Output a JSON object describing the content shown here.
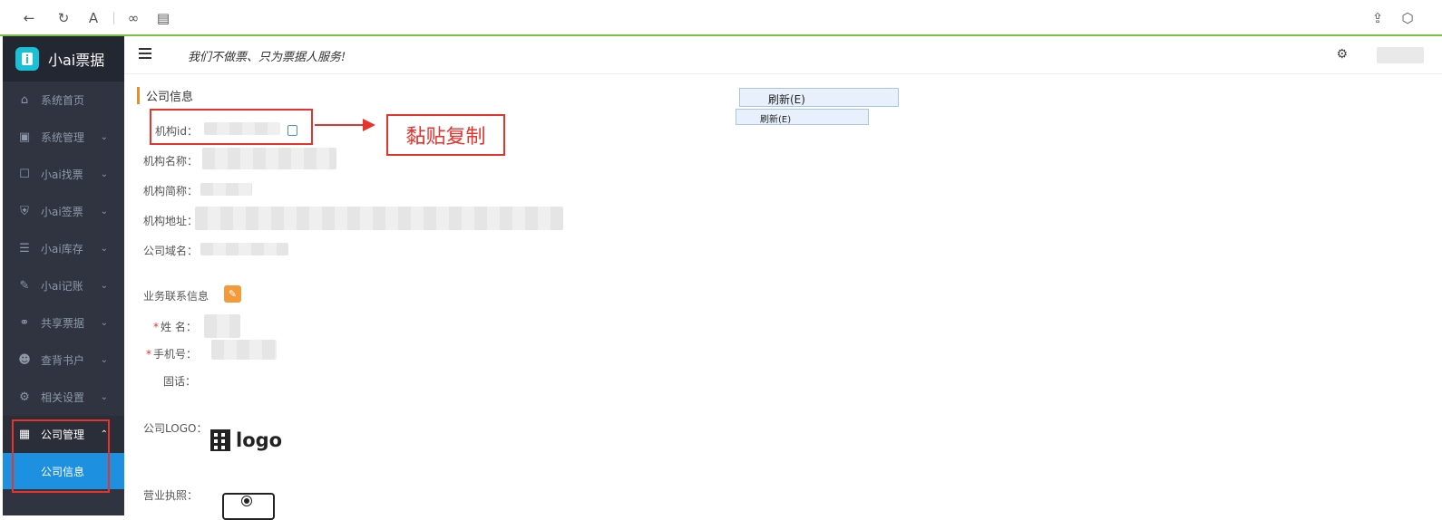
{
  "browser": {
    "icons": [
      "back-icon",
      "refresh-icon",
      "font-icon",
      "link-icon",
      "window-icon",
      "share-icon",
      "cube-icon"
    ]
  },
  "sidebar": {
    "app_name": "小ai票据",
    "items": [
      {
        "label": "系统首页",
        "icon": "home-icon",
        "has_chevron": false
      },
      {
        "label": "系统管理",
        "icon": "monitor-icon",
        "has_chevron": true
      },
      {
        "label": "小ai找票",
        "icon": "search-doc-icon",
        "has_chevron": true
      },
      {
        "label": "小ai签票",
        "icon": "shield-icon",
        "has_chevron": true
      },
      {
        "label": "小ai库存",
        "icon": "list-icon",
        "has_chevron": true
      },
      {
        "label": "小ai记账",
        "icon": "edit-icon",
        "has_chevron": true
      },
      {
        "label": "共享票据",
        "icon": "share-nodes-icon",
        "has_chevron": true
      },
      {
        "label": "查背书户",
        "icon": "user-icon",
        "has_chevron": true
      },
      {
        "label": "相关设置",
        "icon": "gear-icon",
        "has_chevron": true
      },
      {
        "label": "公司管理",
        "icon": "building-icon",
        "has_chevron": true,
        "expanded": true
      }
    ],
    "sub_item": "公司信息"
  },
  "header": {
    "slogan": "我们不做票、只为票据人服务!"
  },
  "main": {
    "section_title": "公司信息",
    "fields": {
      "org_id_label": "机构id：",
      "org_name_label": "机构名称：",
      "org_short_label": "机构简称：",
      "org_address_label": "机构地址：",
      "domain_label": "公司域名：",
      "contact_title": "业务联系信息",
      "name_label": "姓 名：",
      "phone_label": "手机号：",
      "tel_label": "固话：",
      "logo_label": "公司LOGO：",
      "logo_text": "logo",
      "license_label": "营业执照："
    },
    "required_mark": "*"
  },
  "context_menu": {
    "item1": "刷新(E)",
    "item2": "刷新(E)"
  },
  "annotation": {
    "label": "黏贴复制"
  },
  "colors": {
    "sidebar_bg": "#2f3440",
    "active_blue": "#1e90e0",
    "accent_orange": "#ef8a2a",
    "annotation_red": "#e8332c",
    "browser_green": "#7cc242"
  }
}
